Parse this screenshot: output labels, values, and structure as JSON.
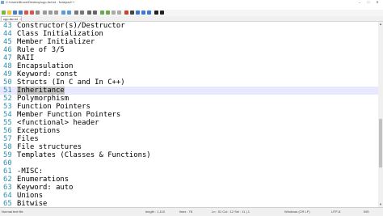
{
  "window": {
    "title": "C:\\Users\\Bruce\\Desktop\\cpp-list.txt - Notepad++",
    "min": "–",
    "max": "□",
    "close": "✕"
  },
  "menu": [
    "File",
    "Edit",
    "Search",
    "View",
    "Encoding",
    "Language",
    "Settings",
    "Tools",
    "Macro",
    "Run",
    "Plugins",
    "Window",
    "?"
  ],
  "tab": {
    "label": "cpp-list.txt",
    "close": "×"
  },
  "editor": {
    "lines": [
      {
        "num": "43",
        "text": "Constructor(s)/Destructor"
      },
      {
        "num": "44",
        "text": "Class Initialization"
      },
      {
        "num": "45",
        "text": "Member Initializer"
      },
      {
        "num": "46",
        "text": "Rule of 3/5"
      },
      {
        "num": "47",
        "text": "RAII"
      },
      {
        "num": "48",
        "text": "Encapsulation"
      },
      {
        "num": "49",
        "text": "Keyword: const"
      },
      {
        "num": "50",
        "text": "Structs (In C and In C++)"
      },
      {
        "num": "51",
        "text": "Inheritance"
      },
      {
        "num": "52",
        "text": "Polymorphism"
      },
      {
        "num": "53",
        "text": "Function Pointers"
      },
      {
        "num": "54",
        "text": "Member Function Pointers"
      },
      {
        "num": "55",
        "text": "<functional> header"
      },
      {
        "num": "56",
        "text": "Exceptions"
      },
      {
        "num": "57",
        "text": "Files"
      },
      {
        "num": "58",
        "text": "File structures"
      },
      {
        "num": "59",
        "text": "Templates (Classes & Functions)"
      },
      {
        "num": "60",
        "text": ""
      },
      {
        "num": "61",
        "text": "-MISC:"
      },
      {
        "num": "62",
        "text": "Enumerations"
      },
      {
        "num": "63",
        "text": "Keyword: auto"
      },
      {
        "num": "64",
        "text": "Unions"
      },
      {
        "num": "65",
        "text": "Bitwise"
      }
    ],
    "current_line_index": 8
  },
  "status": {
    "file_type": "Normal text file",
    "length": "length : 1,110",
    "lines": "lines : 78",
    "position": "Ln : 51    Col : 12    Sel : 11 | 1",
    "eol": "Windows (CR LF)",
    "encoding": "UTF-8",
    "mode": "INS"
  },
  "colors": {
    "line_number": "#2b91af",
    "current_line": "#e8e8ff",
    "selection": "#c0c0c0"
  }
}
